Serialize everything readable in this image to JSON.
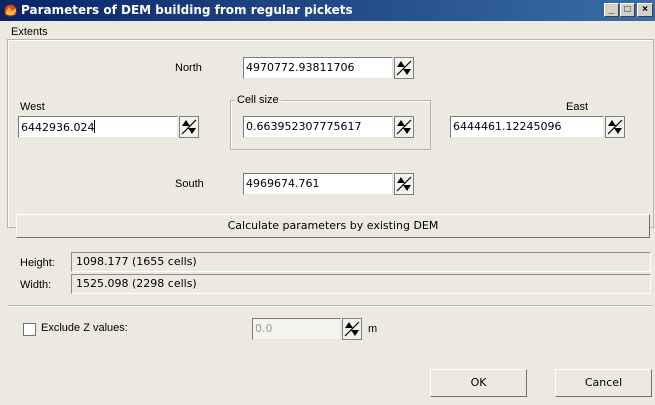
{
  "window": {
    "title": "Parameters of DEM building from regular pickets"
  },
  "titlebar_buttons": {
    "minimize": "_",
    "maximize": "□",
    "close": "×"
  },
  "extents": {
    "group_title": "Extents",
    "north_label": "North",
    "north_value": "4970772.93811706",
    "west_label": "West",
    "west_value": "6442936.024",
    "east_label": "East",
    "east_value": "6444461.12245096",
    "south_label": "South",
    "south_value": "4969674.761",
    "cell_size_title": "Cell size",
    "cell_size_value": "0.663952307775617"
  },
  "calculate_button": "Calculate parameters by existing DEM",
  "info": {
    "height_label": "Height:",
    "height_value": "1098.177 (1655 cells)",
    "width_label": "Width:",
    "width_value": "1525.098 (2298 cells)"
  },
  "exclude": {
    "label": "Exclude Z values:",
    "checked": false,
    "value": "0.0",
    "unit": "m"
  },
  "footer": {
    "ok": "OK",
    "cancel": "Cancel"
  },
  "icons": {
    "app": "dem-app-icon",
    "spin": "spin-arrows-icon"
  },
  "colors": {
    "titlebar_start": "#0a246a",
    "titlebar_end": "#3a6ea5",
    "dialog_bg": "#ece9e0"
  }
}
